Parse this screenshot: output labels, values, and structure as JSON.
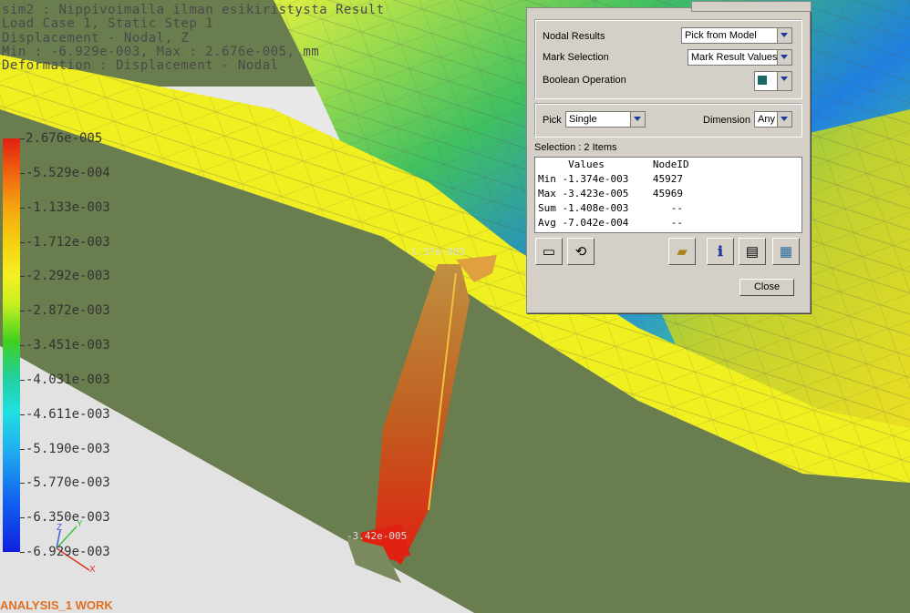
{
  "header": {
    "line1": "sim2 : Nippivoimalla ilman esikiristysta Result",
    "line2": "Load Case 1, Static Step 1",
    "line3": "Displacement - Nodal, Z",
    "line4": "Min : -6.929e-003, Max : 2.676e-005, mm",
    "line5": "Deformation : Displacement - Nodal"
  },
  "legend": {
    "labels": [
      "2.676e-005",
      "-5.529e-004",
      "-1.133e-003",
      "-1.712e-003",
      "-2.292e-003",
      "-2.872e-003",
      "-3.451e-003",
      "-4.031e-003",
      "-4.611e-003",
      "-5.190e-003",
      "-5.770e-003",
      "-6.350e-003",
      "-6.929e-003"
    ]
  },
  "viewport": {
    "node_label_top": "-1.37e-003",
    "node_label_bottom": "-3.42e-005",
    "status_label": "ANALYSIS_1 WORK",
    "axis_z": "Z",
    "axis_y": "Y",
    "axis_x": "X"
  },
  "colors": {
    "plate_green": "#6a7d4e",
    "background_gray": "#e8e8e8",
    "status_orange": "#e07020"
  },
  "dialog": {
    "nodal_results_label": "Nodal Results",
    "nodal_results_value": "Pick from Model",
    "mark_selection_label": "Mark Selection",
    "mark_selection_value": "Mark Result Values",
    "boolean_operation_label": "Boolean Operation",
    "pick_label": "Pick",
    "pick_value": "Single",
    "dimension_label": "Dimension",
    "dimension_value": "Any",
    "selection_text": "Selection : 2 Items",
    "table_header": "     Values        NodeID",
    "rows": [
      "Min -1.374e-003    45927",
      "Max -3.423e-005    45969",
      "Sum -1.408e-003       --",
      "Avg -7.042e-004       --"
    ],
    "close_label": "Close"
  }
}
